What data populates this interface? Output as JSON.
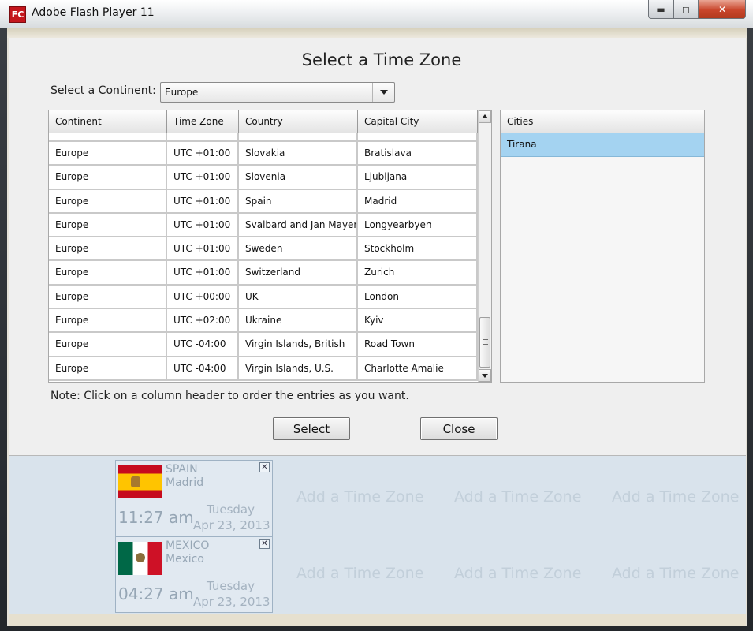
{
  "window": {
    "title": "Adobe Flash Player 11",
    "icon_text": "FC",
    "icon_name": "flash-player-icon",
    "controls": {
      "minimize": "▬",
      "maximize": "◻",
      "close": "✕"
    }
  },
  "dialog": {
    "title": "Select a Time Zone",
    "continent_label": "Select a Continent:",
    "continent_value": "Europe",
    "table": {
      "columns": [
        "Continent",
        "Time Zone",
        "Country",
        "Capital City"
      ],
      "rows": [
        {
          "continent": "Europe",
          "timezone": "UTC +01:00",
          "country": "Slovakia",
          "capital": "Bratislava"
        },
        {
          "continent": "Europe",
          "timezone": "UTC +01:00",
          "country": "Slovenia",
          "capital": "Ljubljana"
        },
        {
          "continent": "Europe",
          "timezone": "UTC +01:00",
          "country": "Spain",
          "capital": "Madrid"
        },
        {
          "continent": "Europe",
          "timezone": "UTC +01:00",
          "country": "Svalbard and Jan Mayen",
          "capital": "Longyearbyen"
        },
        {
          "continent": "Europe",
          "timezone": "UTC +01:00",
          "country": "Sweden",
          "capital": "Stockholm"
        },
        {
          "continent": "Europe",
          "timezone": "UTC +01:00",
          "country": "Switzerland",
          "capital": "Zurich"
        },
        {
          "continent": "Europe",
          "timezone": "UTC +00:00",
          "country": "UK",
          "capital": "London"
        },
        {
          "continent": "Europe",
          "timezone": "UTC +02:00",
          "country": "Ukraine",
          "capital": "Kyiv"
        },
        {
          "continent": "Europe",
          "timezone": "UTC -04:00",
          "country": "Virgin Islands, British",
          "capital": "Road Town"
        },
        {
          "continent": "Europe",
          "timezone": "UTC -04:00",
          "country": "Virgin Islands, U.S.",
          "capital": "Charlotte Amalie"
        }
      ]
    },
    "cities": {
      "header": "Cities",
      "items": [
        "Tirana"
      ]
    },
    "note": "Note: Click on a column header to order the entries as you want.",
    "buttons": {
      "select": "Select",
      "close": "Close"
    }
  },
  "clocks": [
    {
      "country": "SPAIN",
      "city": "Madrid",
      "time": "11:27 am",
      "day": "Tuesday",
      "date": "Apr 23, 2013",
      "flag": "spain-flag-icon"
    },
    {
      "country": "MEXICO",
      "city": "Mexico",
      "time": "04:27 am",
      "day": "Tuesday",
      "date": "Apr 23, 2013",
      "flag": "mexico-flag-icon"
    }
  ],
  "placeholders": {
    "add_label": "Add a Time Zone"
  },
  "colors": {
    "selection": "#a4d3f1",
    "close_button": "#c9462c",
    "clock_text": "#96a6b5"
  }
}
